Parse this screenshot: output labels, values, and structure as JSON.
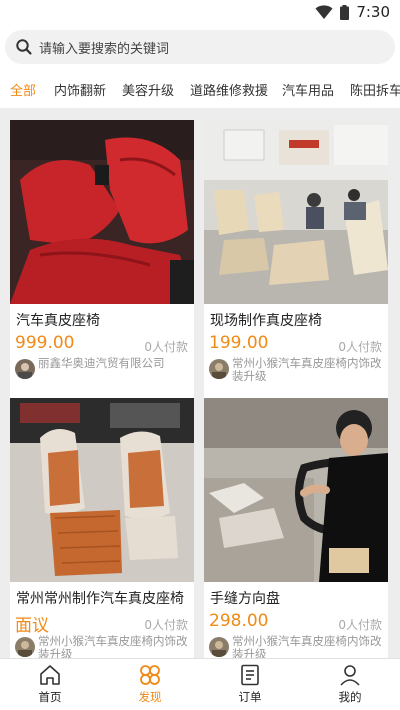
{
  "status_bar": {
    "time": "7:30"
  },
  "search": {
    "placeholder": "请输入要搜索的关键词"
  },
  "tabs": [
    {
      "label": "全部",
      "active": true
    },
    {
      "label": "内饰翻新"
    },
    {
      "label": "美容升级"
    },
    {
      "label": "道路维修救援"
    },
    {
      "label": "汽车用品"
    },
    {
      "label": "陈田拆车件"
    }
  ],
  "products": [
    {
      "title": "汽车真皮座椅",
      "price": "999.00",
      "sales": "0人付款",
      "shop": "丽鑫华奥迪汽贸有限公司"
    },
    {
      "title": "现场制作真皮座椅",
      "price": "199.00",
      "sales": "0人付款",
      "shop": "常州小猴汽车真皮座椅内饰改装升级"
    },
    {
      "title": "常州常州制作汽车真皮座椅",
      "price": "面议",
      "sales": "0人付款",
      "shop": "常州小猴汽车真皮座椅内饰改装升级"
    },
    {
      "title": "手缝方向盘",
      "price": "298.00",
      "sales": "0人付款",
      "shop": "常州小猴汽车真皮座椅内饰改装升级"
    }
  ],
  "bottom_nav": [
    {
      "label": "首页",
      "icon": "home-icon"
    },
    {
      "label": "发现",
      "icon": "discover-icon",
      "active": true
    },
    {
      "label": "订单",
      "icon": "orders-icon"
    },
    {
      "label": "我的",
      "icon": "profile-icon"
    }
  ],
  "colors": {
    "accent": "#f08a17",
    "background": "#ededed"
  }
}
